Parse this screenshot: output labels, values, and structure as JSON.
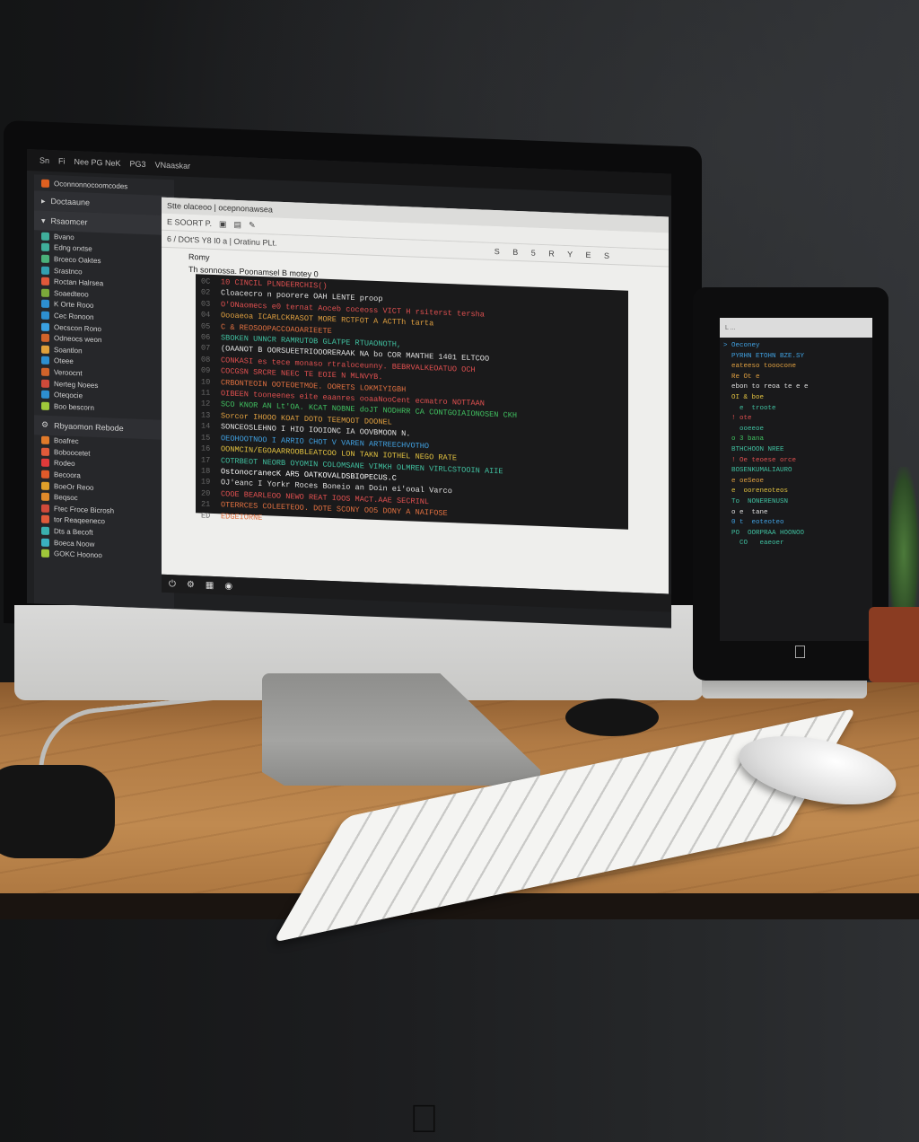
{
  "scene": {
    "description": "Desk setup with an iMac-style computer showing a code editor, a secondary vertical monitor with code, white keyboard and mouse on a wooden desk",
    "colors": {
      "wall": "#1c1d1f",
      "desk": "#b07a44",
      "screen_bg": "#1f2022",
      "doc_bg": "#eeeeec",
      "code_bg": "#1a1a1b"
    }
  },
  "main_screen": {
    "menubar": [
      "Sn",
      "Fi",
      "Nee PG NeK",
      "PG3",
      "VNaaskar"
    ],
    "sidebar": {
      "top_item": "Oconnonnocoomcodes",
      "section1": "Doctaaune",
      "section2": "Rsaomcer",
      "items": [
        {
          "label": "Bvano",
          "color": "#3fae9a"
        },
        {
          "label": "Edng orxtse",
          "color": "#3fae9a"
        },
        {
          "label": "Brceco Oaktes",
          "color": "#4ab07a"
        },
        {
          "label": "Srastnco",
          "color": "#33a0b0"
        },
        {
          "label": "Roctan Halrsea",
          "color": "#e0583a"
        },
        {
          "label": "Soaedteoo",
          "color": "#7ba83a"
        },
        {
          "label": "K Orte Rooo",
          "color": "#2d8fd0"
        },
        {
          "label": "Cec Ronoon",
          "color": "#2d8fd0"
        },
        {
          "label": "Oecscon Rono",
          "color": "#3aa0e0"
        },
        {
          "label": "Odneocs weon",
          "color": "#d0632a"
        },
        {
          "label": "Soantlon",
          "color": "#e0a03a"
        },
        {
          "label": "Oteee",
          "color": "#2d8fd0"
        },
        {
          "label": "Veroocnt",
          "color": "#d0632a"
        },
        {
          "label": "Nerteg Noees",
          "color": "#d04a3a"
        },
        {
          "label": "Oteqocie",
          "color": "#2d8fd0"
        },
        {
          "label": "Boo bescorn",
          "color": "#a0c83a"
        }
      ],
      "section3": "Rbyaomon Rebode",
      "items2": [
        {
          "label": "Boafrec",
          "color": "#e07a2a"
        },
        {
          "label": "Boboocetet",
          "color": "#e05a3a"
        },
        {
          "label": "Rodeo",
          "color": "#e03a3a"
        },
        {
          "label": "Becoora",
          "color": "#e05a2a"
        },
        {
          "label": "BoeOr Reoo",
          "color": "#e0a02a"
        },
        {
          "label": "Beqsoc",
          "color": "#e08a2a"
        },
        {
          "label": "Ftec Froce Bicrosh",
          "color": "#d04a3a"
        },
        {
          "label": "tor Reaqeeneco",
          "color": "#e05a3a"
        },
        {
          "label": "Dts a Becoft",
          "color": "#3ab0b0"
        },
        {
          "label": "Boeca Noow",
          "color": "#3ab0c0"
        },
        {
          "label": "GOKC Hoonoo",
          "color": "#a0c83a"
        }
      ]
    },
    "document": {
      "tab_title": "Stte olaceoo | ocepnonawsea",
      "toolbar1": "E  SOORT  P.",
      "toolbar2": "6 / DOt'S   Y8 I0 a   |   Oratinu PLt.",
      "toolbar2_right": "S B 5 R Y E S",
      "heading": "Romy",
      "subheading": "Th sonnossa.  Poonamsel  B motey  0",
      "code_lines": [
        {
          "g": "0C",
          "t": "10 CINCIL PLNDEERCHIS()",
          "c": "#e05050"
        },
        {
          "g": "",
          "t": "Cloacecro n poorere OAH LENTE proop",
          "c": "#e0e0e0"
        },
        {
          "g": "",
          "t": "O'ONaomecs e0 ternat Aoceb coceoss  VICT H  rsiterst tersha",
          "c": "#e05050"
        },
        {
          "g": "",
          "t": "Oooaeoa   ICARLCKRASOT MORE RCTFOT A ACTTh tarta",
          "c": "#e0a040"
        },
        {
          "g": "",
          "t": "C & REOSOOPACCOAOARIEETE",
          "c": "#e07040"
        },
        {
          "g": "",
          "t": "SBOKEN UNNCR RAMRUTOB GLATPE RTUAONOTH,",
          "c": "#40c0a0"
        },
        {
          "g": "",
          "t": "(OAANOT B  OORSUEETRIOOORERAAK  NA bo  COR MANTHE  1401  ELTCOO",
          "c": "#e0e0e0"
        },
        {
          "g": "",
          "t": "CONKASI es tece monaso rtraloceunny. BEBRVALKEOATUO OCH",
          "c": "#e05050"
        },
        {
          "g": "",
          "t": "COCGSN SRCRE NEEC TE EOIE N MLNVYB.",
          "c": "#e05050"
        },
        {
          "g": "",
          "t": "CRBONTEOIN OOTEOETMOE. OORETS LOKMIYIGBH",
          "c": "#e07040"
        },
        {
          "g": "",
          "t": "OIBEEN  tooneenes eite eaanres ooaaNooCent ecmatro NOTTAAN",
          "c": "#e05050"
        },
        {
          "g": "",
          "t": "SCO KNOR AN Lt'OA. KCAT NOBNE doJT NODHRR CA CONTGOIAIONOSEN CKH",
          "c": "#40c060"
        },
        {
          "g": "",
          "t": "Sorcor IHOOO KOAT DOTO TEEMOOT DOONEL",
          "c": "#e0a040"
        },
        {
          "g": "",
          "t": "SONCEOSLEHNO I HIO IOOIONC IA OOVBMOON N.",
          "c": "#e0e0e0"
        },
        {
          "g": "",
          "t": "OEOHOOTNOO I ARRIO CHOT V VAREN ARTREECHVOTHO",
          "c": "#40a0e0"
        },
        {
          "g": "",
          "t": "OONMCIN/EGOAARROOBLEATCOO LON TAKN IOTHEL NEGO RATE",
          "c": "#e0c040"
        },
        {
          "g": "",
          "t": "COTRBEOT NEORB OYOMIN COLOMSANE VIMKH OLMREN VIRLCSTOOIN AIIE",
          "c": "#40c0a0"
        },
        {
          "g": "",
          "t": "OstonocranecK AR5 OATKOVALDSBIOPECUS.C",
          "c": "#ffffff"
        },
        {
          "g": "",
          "t": "OJ'eanc I  Yorkr Roces Boneio an Doin ei'ooal Varco",
          "c": "#e0e0e0"
        },
        {
          "g": "",
          "t": "COOE BEARLEOO NEWO REAT IOOS MACT.AAE SECRINL",
          "c": "#e05050"
        },
        {
          "g": "",
          "t": "OTERRCES  COLEETEOO. DOTE SCONY  OO5 DONY A NAIFOSE",
          "c": "#e07040"
        },
        {
          "g": "ED",
          "t": "EDGEIORNE",
          "c": "#e07040"
        }
      ]
    },
    "status_footer": "aO"
  },
  "second_monitor": {
    "address_bar": "L ... ",
    "code_lines": [
      {
        "t": "> Oeconey",
        "c": "#40a0e0"
      },
      {
        "t": "  PYRHN ETOHN BZE.SY",
        "c": "#40a0e0"
      },
      {
        "t": "  eateeso tooocone",
        "c": "#e0a040"
      },
      {
        "t": "  Re Ot e",
        "c": "#e0a040"
      },
      {
        "t": "  ebon to reoa te e e",
        "c": "#e0e0e0"
      },
      {
        "t": "  OI & boe",
        "c": "#e0c040"
      },
      {
        "t": "    e  troote",
        "c": "#40c0a0"
      },
      {
        "t": "  ! ote",
        "c": "#e05050"
      },
      {
        "t": "    ooeeoe",
        "c": "#40c0a0"
      },
      {
        "t": "  o 3 bana",
        "c": "#40c060"
      },
      {
        "t": "  BTHCHOON NREE",
        "c": "#40c0a0"
      },
      {
        "t": "  ! Oe teoese orce",
        "c": "#e05050"
      },
      {
        "t": "  BOSENKUMALIAURO",
        "c": "#40c0a0"
      },
      {
        "t": "  e oeSeoe",
        "c": "#e0a040"
      },
      {
        "t": "  e  ooreneoteos",
        "c": "#e0c040"
      },
      {
        "t": "  To  NONERENUSN",
        "c": "#40c0a0"
      },
      {
        "t": "  o e  tane",
        "c": "#e0e0e0"
      },
      {
        "t": "  0 t  eoteoteo",
        "c": "#40a0e0"
      },
      {
        "t": "  PO  OORPRAA HOONOO",
        "c": "#40c0a0"
      },
      {
        "t": "    CO   eaeoer",
        "c": "#40c0a0"
      }
    ]
  }
}
